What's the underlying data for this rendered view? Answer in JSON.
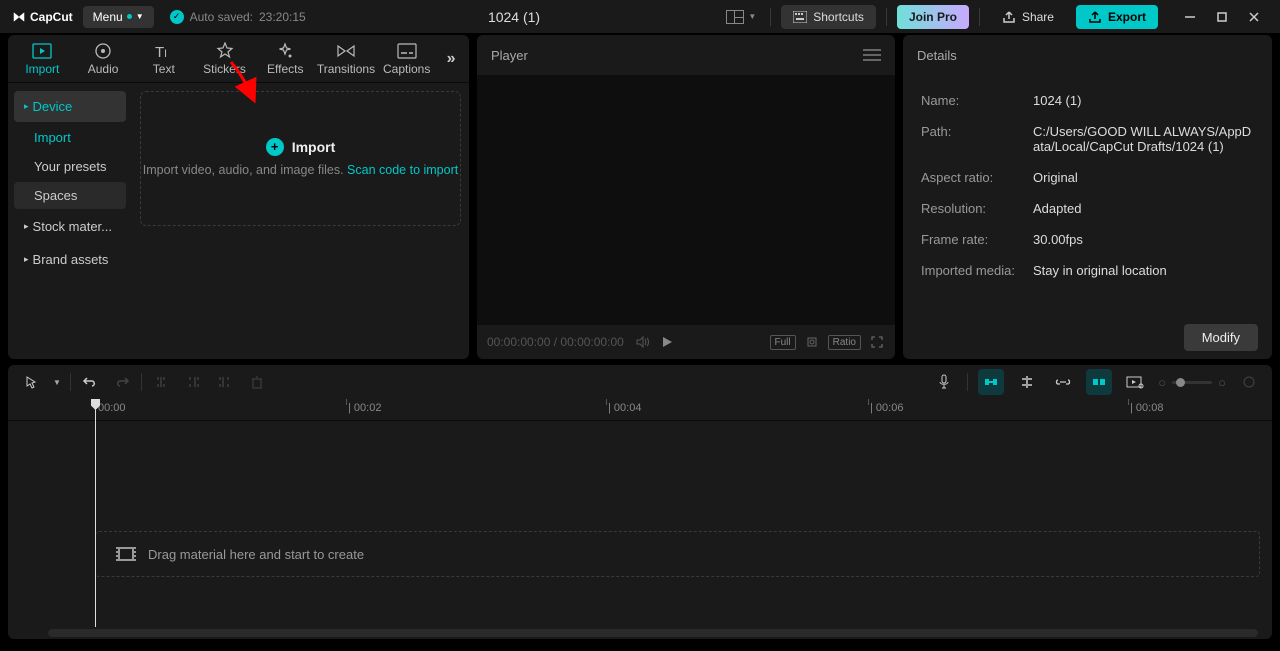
{
  "app": {
    "name": "CapCut"
  },
  "titlebar": {
    "menu": "Menu",
    "autosave_prefix": "Auto saved:",
    "autosave_time": "23:20:15",
    "project_title": "1024 (1)",
    "shortcuts": "Shortcuts",
    "join_pro": "Join Pro",
    "share": "Share",
    "export": "Export"
  },
  "media_tabs": {
    "items": [
      {
        "label": "Import"
      },
      {
        "label": "Audio"
      },
      {
        "label": "Text"
      },
      {
        "label": "Stickers"
      },
      {
        "label": "Effects"
      },
      {
        "label": "Transitions"
      },
      {
        "label": "Captions"
      }
    ]
  },
  "side_nav": {
    "device": "Device",
    "import": "Import",
    "presets": "Your presets",
    "spaces": "Spaces",
    "stock": "Stock mater...",
    "brand": "Brand assets"
  },
  "import_box": {
    "title": "Import",
    "desc": "Import video, audio, and image files. ",
    "link": "Scan code to import"
  },
  "player": {
    "title": "Player",
    "timecode": "00:00:00:00 / 00:00:00:00",
    "badge_full": "Full",
    "badge_ratio": "Ratio"
  },
  "details": {
    "title": "Details",
    "name_label": "Name:",
    "name_value": "1024 (1)",
    "path_label": "Path:",
    "path_value": "C:/Users/GOOD WILL ALWAYS/AppData/Local/CapCut Drafts/1024 (1)",
    "aspect_label": "Aspect ratio:",
    "aspect_value": "Original",
    "res_label": "Resolution:",
    "res_value": "Adapted",
    "fps_label": "Frame rate:",
    "fps_value": "30.00fps",
    "media_label": "Imported media:",
    "media_value": "Stay in original location",
    "modify": "Modify"
  },
  "timeline": {
    "ticks": [
      "00:00",
      "| 00:02",
      "| 00:04",
      "| 00:06",
      "| 00:08"
    ],
    "drop_hint": "Drag material here and start to create"
  }
}
